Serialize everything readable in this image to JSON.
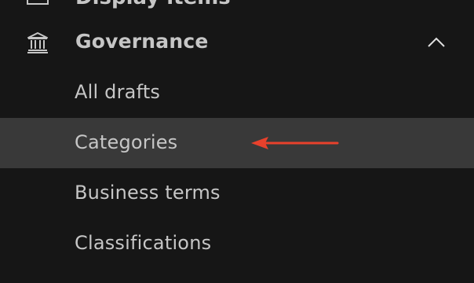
{
  "top_item": {
    "label": "Display items",
    "icon": "table-icon"
  },
  "section": {
    "label": "Governance",
    "icon": "institution-icon",
    "expanded_icon": "chevron-up-icon"
  },
  "items": [
    {
      "label": "All drafts"
    },
    {
      "label": "Categories",
      "active": true
    },
    {
      "label": "Business terms"
    },
    {
      "label": "Classifications"
    }
  ],
  "annotation": {
    "arrow_color": "#e8412c"
  },
  "colors": {
    "background": "#161616",
    "active_row": "#393939",
    "text": "#c6c6c6"
  }
}
